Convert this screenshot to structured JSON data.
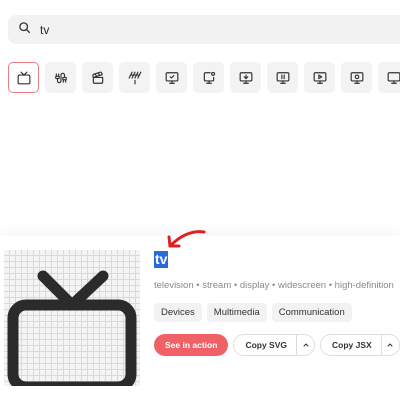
{
  "search": {
    "value": "tv",
    "icon": "search-icon"
  },
  "results": [
    {
      "icon": "tv-icon",
      "selected": true
    },
    {
      "icon": "cable-icon",
      "selected": false
    },
    {
      "icon": "clapperboard-icon",
      "selected": false
    },
    {
      "icon": "antenna-icon",
      "selected": false
    },
    {
      "icon": "monitor-check-icon",
      "selected": false
    },
    {
      "icon": "monitor-cog-icon",
      "selected": false
    },
    {
      "icon": "monitor-down-icon",
      "selected": false
    },
    {
      "icon": "monitor-pause-icon",
      "selected": false
    },
    {
      "icon": "monitor-play-icon",
      "selected": false
    },
    {
      "icon": "monitor-speaker-icon",
      "selected": false
    },
    {
      "icon": "monitor-icon",
      "selected": false
    }
  ],
  "detail": {
    "name": "tv",
    "tags": "television • stream • display • widescreen • high-definition",
    "categories": [
      "Devices",
      "Multimedia",
      "Communication"
    ],
    "see_in_action": "See in action",
    "copy_svg": "Copy SVG",
    "copy_jsx": "Copy JSX"
  },
  "colors": {
    "accent": "#ef6167",
    "selection": "#2a6ad9",
    "annotation_arrow": "#e02020"
  }
}
